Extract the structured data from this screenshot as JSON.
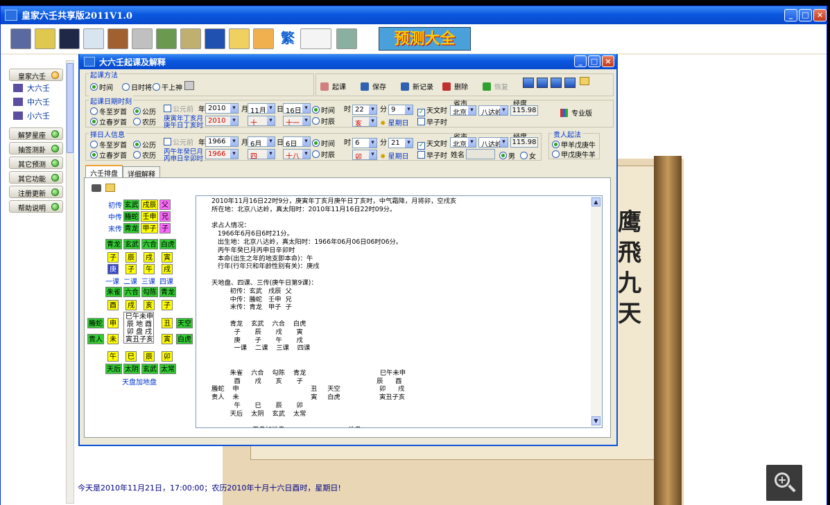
{
  "app": {
    "title": "皇家六壬共享版2011V1.0",
    "banner": "预测大全"
  },
  "sidebar": {
    "items": [
      {
        "label": "皇家六壬",
        "accent": "orange"
      },
      {
        "label": "解梦星座"
      },
      {
        "label": "抽签测卦"
      },
      {
        "label": "其它预测"
      },
      {
        "label": "其它功能"
      },
      {
        "label": "注册更新"
      },
      {
        "label": "帮助说明"
      }
    ],
    "tree": [
      "大六壬",
      "中六壬",
      "小六壬"
    ]
  },
  "scroll_text": [
    "鹰",
    "飛",
    "九",
    "天"
  ],
  "status": "今天是2010年11月21日，17:00:00；农历2010年十月十六日酉时，星期日!",
  "dialog": {
    "title": "大六壬起课及解释",
    "method": {
      "label": "起课方法",
      "options": [
        "时间",
        "日时将",
        "干上神"
      ],
      "selected": "时间"
    },
    "actions": [
      "起课",
      "保存",
      "新记录",
      "删除",
      "恢复"
    ],
    "divination_date": {
      "label": "起课日期时刻",
      "season": [
        "冬至岁首",
        "立春岁首"
      ],
      "calendar": [
        "公历",
        "农历"
      ],
      "bc_label": "公元前",
      "year_label": "年",
      "month_label": "月",
      "day_label": "日",
      "ganzhi_1": "庚寅年丁亥月",
      "ganzhi_2": "庚午日丁亥时",
      "year": "2010",
      "month": "11月",
      "day": "16日",
      "lunar_year": "2010",
      "lunar_month": "十",
      "lunar_day": "十一",
      "time_mode": [
        "时间",
        "时辰"
      ],
      "hour_label": "时",
      "minute_label": "分",
      "hour": "22",
      "minute": "9",
      "shichen": "亥",
      "weekday": "星期日",
      "solar_time": "天文时",
      "zi_hour": "早子时",
      "province_label": "省市",
      "province": "北京",
      "city": "八达岭",
      "lon_label": "经度",
      "longitude": "115.98",
      "edition": "专业版"
    },
    "person": {
      "label": "择日人信息",
      "season": [
        "冬至岁首",
        "立春岁首"
      ],
      "calendar": [
        "公历",
        "农历"
      ],
      "bc_label": "公元前",
      "year_label": "年",
      "month_label": "月",
      "day_label": "日",
      "ganzhi_1": "丙午年癸巳月",
      "ganzhi_2": "丙申日辛卯时",
      "year": "1966",
      "month": "6月",
      "day": "6日",
      "lunar_year": "1966",
      "lunar_month": "四",
      "lunar_day": "十八",
      "time_mode": [
        "时间",
        "时辰"
      ],
      "hour_label": "时",
      "minute_label": "分",
      "hour": "6",
      "minute": "21",
      "shichen": "卯",
      "weekday": "星期日",
      "solar_time": "天文时",
      "zi_hour": "早子时",
      "name_label": "姓名",
      "province_label": "省市",
      "province": "北京",
      "city": "八达岭",
      "lon_label": "经度",
      "longitude": "115.98",
      "gender": [
        "男",
        "女"
      ]
    },
    "noble": {
      "label": "贵人起法",
      "options": [
        "甲羊戊庚牛",
        "甲戊庚牛羊"
      ]
    },
    "tabs": [
      "六壬排盘",
      "详细解释"
    ],
    "chart": {
      "chuan_labels": [
        "初传",
        "中传",
        "末传"
      ],
      "chuan": [
        [
          "玄武",
          "戌辰",
          "父"
        ],
        [
          "螣蛇",
          "壬申",
          "兄"
        ],
        [
          "青龙",
          "甲子",
          "子"
        ]
      ],
      "ke_gods": [
        "青龙",
        "玄武",
        "六合",
        "白虎"
      ],
      "ke_top": [
        "子",
        "辰",
        "戌",
        "寅"
      ],
      "ke_bottom": [
        "庚",
        "子",
        "午",
        "戌"
      ],
      "ke_labels": [
        "一课",
        "二课",
        "三课",
        "四课"
      ],
      "top_gods": [
        "朱雀",
        "六合",
        "勾陈",
        "青龙"
      ],
      "top_branch": [
        "酉",
        "戌",
        "亥",
        "子"
      ],
      "left_gods": [
        "螣蛇",
        "贵人"
      ],
      "left_branch": [
        "申",
        "未"
      ],
      "right_branch": [
        "丑",
        "寅"
      ],
      "right_gods": [
        "天空",
        "白虎"
      ],
      "center": [
        "巳午未申",
        "辰 地 酉",
        "卯 盘 戌",
        "寅丑子亥"
      ],
      "bottom_branch": [
        "午",
        "巳",
        "辰",
        "卯"
      ],
      "bottom_gods": [
        "天后",
        "太阴",
        "玄武",
        "太常"
      ],
      "caption": "天盘加地盘"
    },
    "explanation": [
      "2010年11月16日22时9分，庚寅年丁亥月庚午日丁亥时，中气霜降，月将卯，空戌亥",
      "所在地：北京八达岭，真太阳时：2010年11月16日22时09分。",
      "",
      "求占人情况：",
      "   1966年6月6日6时21分。",
      "   出生地：北京八达岭，真太阳时：1966年06月06日06时06分。",
      "   丙午年癸巳月丙申日辛卯时",
      "   本命(出生之年的地支即本命)：午",
      "   行年(行年只和年龄性别有关)：庚戌",
      "",
      "天地盘、四课、三传(庚午日第9课)：",
      "         初传：玄武   戌辰  父",
      "         中传：螣蛇   壬申  兄",
      "         末传：青龙   甲子  子",
      "",
      "         青龙    玄武    六合    白虎",
      "           子       辰       戌       寅",
      "           庚       子       午       戌",
      "           一课    二课    三课    四课",
      "",
      "",
      "         朱雀    六合    勾陈    青龙                                    巳午未申",
      "           酉       戌       亥       子                                    辰      酉",
      "螣蛇    申                                   丑     天空                   卯      戌",
      "贵人    未                                   寅     白虎                   寅丑子亥",
      "           午       巳       辰       卯",
      "         天后    太阴    玄武    太常",
      "",
      "                    天盘加地盘                               地盘"
    ]
  },
  "colors": {
    "title": "#0a58e0",
    "green": "#33cc33",
    "yellow": "#ffff00",
    "pink": "#ff66ff",
    "red": "#cc3333"
  }
}
